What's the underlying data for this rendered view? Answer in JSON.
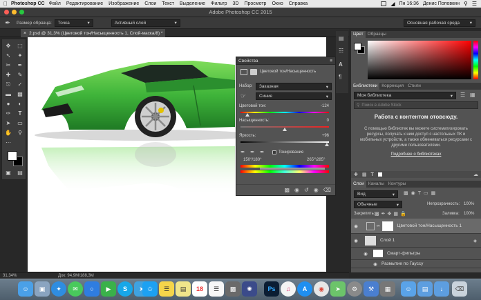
{
  "menubar": {
    "app_name": "Photoshop CC",
    "items": [
      "Файл",
      "Редактирование",
      "Изображение",
      "Слои",
      "Текст",
      "Выделение",
      "Фильтр",
      "3D",
      "Просмотр",
      "Окно",
      "Справка"
    ],
    "clock": "Пн 16:36",
    "user": "Денис Поповкин"
  },
  "window": {
    "title": "Adobe Photoshop CC 2015"
  },
  "options": {
    "sample_size_label": "Размер образца:",
    "sample_size_value": "Точка",
    "sample_layer_value": "Активный слой",
    "workspace_value": "Основная рабочая среда"
  },
  "document": {
    "tab": "2.psd @ 31,3% (Цветовой тон/Насыщенность 1, Слой-маска/8) *"
  },
  "properties": {
    "title": "Свойства",
    "adjustment_name": "Цветовой тон/Насыщенность",
    "preset_label": "Набор:",
    "preset_value": "Заказная",
    "channel_value": "Синие",
    "hue_label": "Цветовой тон:",
    "hue_value": "-124",
    "hue_level": 0.08,
    "saturation_label": "Насыщенность:",
    "saturation_value": "0",
    "saturation_level": 0.5,
    "lightness_label": "Яркость:",
    "lightness_value": "+96",
    "lightness_level": 0.98,
    "colorize_label": "Тонирование",
    "range_left": "150°/180°",
    "range_right": "265°\\285°"
  },
  "color_panel": {
    "tabs": [
      "Цвет",
      "Образцы"
    ]
  },
  "libraries": {
    "tabs": [
      "Библиотеки",
      "Коррекция",
      "Стили"
    ],
    "library_select": "Моя библиотека",
    "search_placeholder": "Поиск в Adobe Stock",
    "heading": "Работа с контентом отовсюду.",
    "body": "С помощью библиотек вы можете систематизировать ресурсы, получать к ним доступ с настольных ПК и мобильных устройств, а также обмениваться ресурсами с другими пользователями.",
    "link": "Подробнее о библиотеках"
  },
  "layers": {
    "tabs": [
      "Слои",
      "Каналы",
      "Контуры"
    ],
    "filter_kind": "Вид",
    "blend_mode": "Обычные",
    "opacity_label": "Непрозрачность:",
    "opacity_value": "100%",
    "lock_label": "Закрепить:",
    "fill_label": "Заливка:",
    "fill_value": "100%",
    "items": [
      {
        "name": "Цветовой тон/Насыщенность 1"
      },
      {
        "name": "Слой 1"
      },
      {
        "name": "Смарт-фильтры"
      },
      {
        "name": "Размытие по Гауссу"
      }
    ]
  },
  "status": {
    "zoom": "31,34%",
    "doc_size": "Док: 94,9M/188,3M"
  },
  "colors": {
    "accent": "#2f6fd6",
    "car_green": "#3fb43a",
    "panel": "#535353"
  }
}
